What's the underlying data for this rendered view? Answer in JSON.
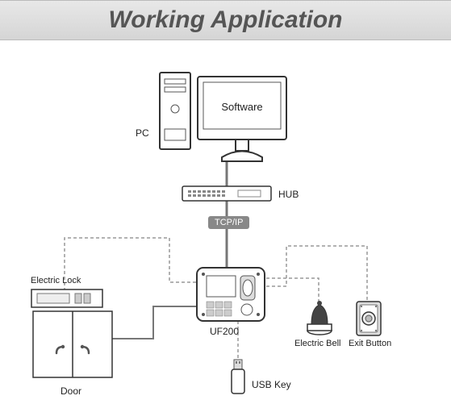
{
  "title": "Working Application",
  "nodes": {
    "pc": {
      "label": "PC",
      "software_text": "Software"
    },
    "hub": {
      "label": "HUB"
    },
    "protocol": {
      "label": "TCP/IP"
    },
    "controller": {
      "label": "UF200"
    },
    "lock": {
      "label": "Electric Lock"
    },
    "door": {
      "label": "Door"
    },
    "usb": {
      "label": "USB Key"
    },
    "bell": {
      "label": "Electric Bell"
    },
    "exit": {
      "label": "Exit Button"
    }
  }
}
